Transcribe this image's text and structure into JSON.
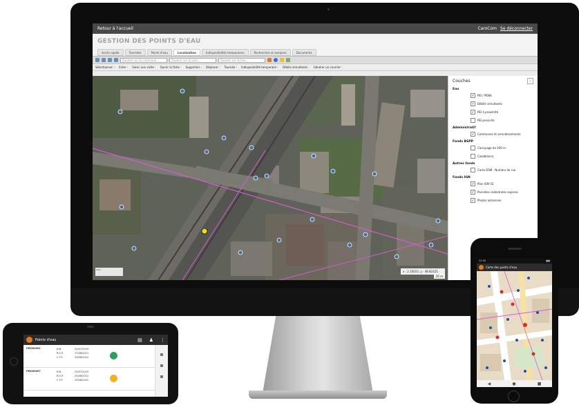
{
  "desktop": {
    "topbar": {
      "back_link": "Retour à l'accueil",
      "user": "CaroCom",
      "logout": "Se déconnecter"
    },
    "title": "GESTION DES POINTS D'EAU",
    "tabs": [
      {
        "label": "Accès rapide"
      },
      {
        "label": "Tournées"
      },
      {
        "label": "Points d'eau"
      },
      {
        "label": "Localisation",
        "active": true
      },
      {
        "label": "Indisponibilités temporaires"
      },
      {
        "label": "Recherches et analyses"
      },
      {
        "label": "Documents"
      }
    ],
    "search": {
      "commune_placeholder": "Zoomer sur la commune...",
      "voie_placeholder": "Zoomer sur la voie...",
      "lieu_placeholder": "Zoomer sur le lieu..."
    },
    "toolbar2": [
      {
        "label": "Sélectionner :"
      },
      {
        "label": "Créer :"
      },
      {
        "label": "Saisir une visite :"
      },
      {
        "label": "Ouvrir la fiche :"
      },
      {
        "label": "Supprimer :"
      },
      {
        "label": "Déplacer :"
      },
      {
        "label": "Tournée :"
      },
      {
        "label": "Indisponibilité temporaire :"
      },
      {
        "label": "Débits simultanés :"
      },
      {
        "label": "Générer un courrier :"
      }
    ],
    "map": {
      "coordinates": "x : 2.35023, y : 48.82325",
      "zoom": "20 m"
    },
    "layers_panel": {
      "title": "Couches",
      "close": "›",
      "groups": [
        {
          "name": "Eau",
          "items": [
            {
              "label": "PEI / PENA",
              "checked": true
            },
            {
              "label": "Débits simultanés",
              "checked": true
            },
            {
              "label": "PEI à proximité",
              "checked": true
            },
            {
              "label": "PEI prescrits",
              "checked": false
            }
          ]
        },
        {
          "name": "Administratif",
          "items": [
            {
              "label": "Communes et arrondissements",
              "checked": true
            }
          ]
        },
        {
          "name": "Fonds BSPP",
          "items": [
            {
              "label": "Carroyage de 200 m",
              "checked": false
            },
            {
              "label": "Casablanca",
              "checked": false
            }
          ]
        },
        {
          "name": "Autres fonds",
          "items": [
            {
              "label": "Carto OSM - Numéro de rue",
              "checked": false
            }
          ]
        },
        {
          "name": "Fonds IGN",
          "items": [
            {
              "label": "Plan IGN V2",
              "checked": true
            },
            {
              "label": "Parcelles cadastrales express",
              "checked": true
            },
            {
              "label": "Photos aériennes",
              "checked": true
            }
          ]
        }
      ]
    },
    "colors": {
      "title_gray": "#a3a3a3",
      "route_magenta": "#d65bd1",
      "marker_blue": "#3f6ea5",
      "topbar": "#484848"
    }
  },
  "tablet": {
    "app_title": "Points d'eau",
    "actions": [
      "▤",
      "♟",
      "⋮"
    ],
    "rows": [
      {
        "id": "PEI000001",
        "labels": [
          "N.B.",
          "R.O.P.",
          "C.T.P."
        ],
        "dates": [
          "01/07/2019",
          "17/06/2021",
          "29/08/2022"
        ],
        "status": "available"
      },
      {
        "id": "PEI000007",
        "labels": [
          "N.B.",
          "R.O.P.",
          "C.T.P."
        ],
        "dates": [
          "25/07/2019",
          "29/06/2021",
          "29/08/2022"
        ],
        "status": "fire"
      }
    ],
    "status_colors": {
      "available": "#2fa05a",
      "fire": "#f0b323"
    }
  },
  "phone": {
    "status_time": "11:30",
    "app_title": "Carte des points d'eau",
    "nav": [
      "◀",
      "●",
      "■"
    ],
    "pin_colors": [
      "#d32f2f",
      "#1e4fb0"
    ]
  }
}
